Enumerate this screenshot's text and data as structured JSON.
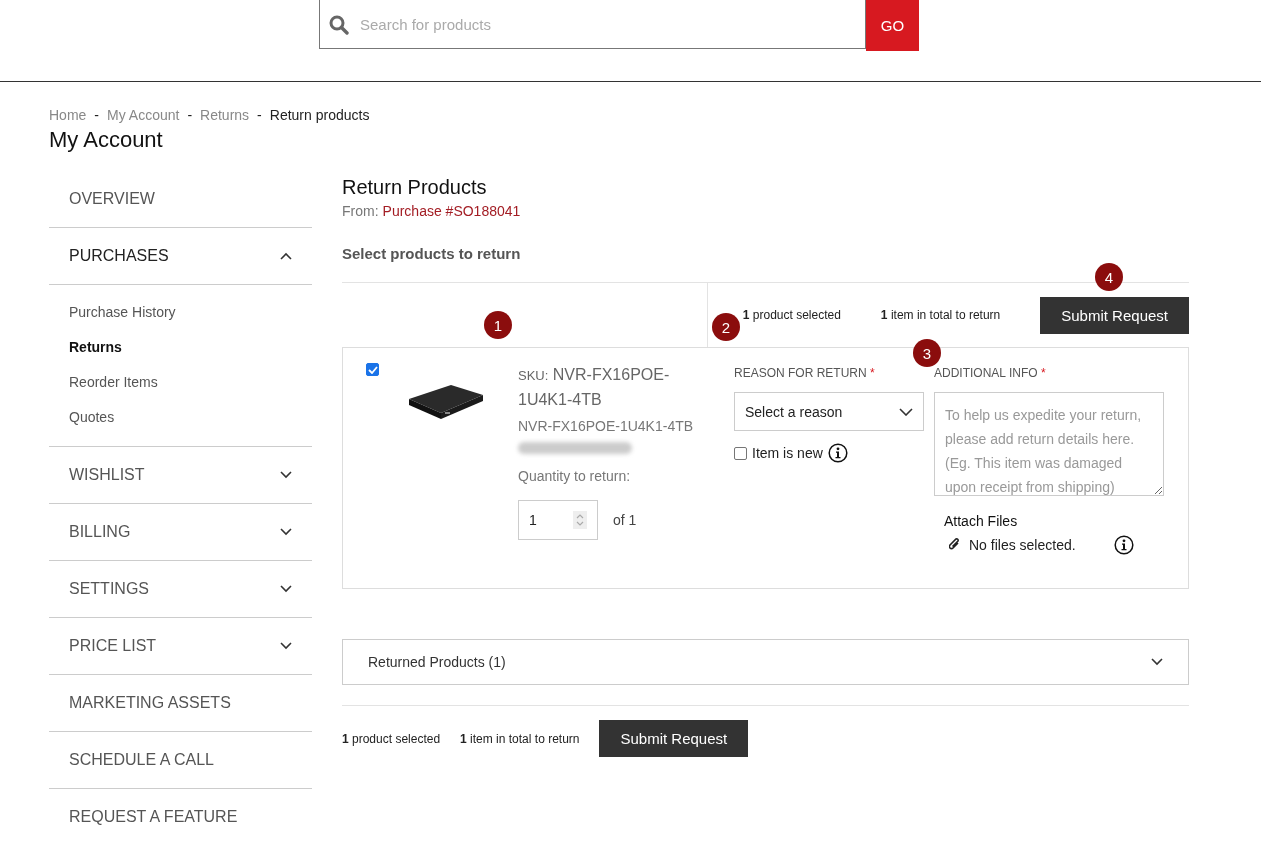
{
  "search": {
    "placeholder": "Search for products",
    "button": "GO"
  },
  "breadcrumbs": [
    {
      "label": "Home",
      "current": false
    },
    {
      "label": "My Account",
      "current": false
    },
    {
      "label": "Returns",
      "current": false
    },
    {
      "label": "Return products",
      "current": true
    }
  ],
  "breadcrumb_separator": "-",
  "page_title": "My Account",
  "sidebar": {
    "items": [
      {
        "label": "OVERVIEW"
      },
      {
        "label": "PURCHASES",
        "expanded": true,
        "children": [
          {
            "label": "Purchase History",
            "selected": false
          },
          {
            "label": "Returns",
            "selected": true
          },
          {
            "label": "Reorder Items",
            "selected": false
          },
          {
            "label": "Quotes",
            "selected": false
          }
        ]
      },
      {
        "label": "WISHLIST",
        "expanded": false
      },
      {
        "label": "BILLING",
        "expanded": false
      },
      {
        "label": "SETTINGS",
        "expanded": false
      },
      {
        "label": "PRICE LIST",
        "expanded": false
      },
      {
        "label": "MARKETING ASSETS"
      },
      {
        "label": "SCHEDULE A CALL"
      },
      {
        "label": "REQUEST A FEATURE"
      }
    ]
  },
  "main": {
    "title": "Return Products",
    "from_label": "From:",
    "from_link": "Purchase #SO188041",
    "subtitle": "Select products to return",
    "summary_top": {
      "selected_count": "1",
      "selected_text": "product selected",
      "total_count": "1",
      "total_text": "item in total to return",
      "button": "Submit Request"
    },
    "product": {
      "checked": true,
      "sku_label": "SKU:",
      "sku": "NVR-FX16POE-1U4K1-4TB",
      "name": "NVR-FX16POE-1U4K1-4TB",
      "quantity_label": "Quantity to return:",
      "quantity": "1",
      "quantity_of": "of 1",
      "reason_label": "REASON FOR RETURN",
      "required_mark": "*",
      "reason_placeholder": "Select a reason",
      "item_is_new_label": "Item is new",
      "item_is_new": false,
      "info_label": "ADDITIONAL INFO",
      "info_placeholder": "To help us expedite your return, please add return details here. (Eg. This item was damaged upon receipt from shipping)",
      "attach_label": "Attach Files",
      "files_text": "No files selected."
    },
    "returned_products": {
      "label": "Returned Products (1)",
      "expanded": false
    },
    "summary_bottom": {
      "selected_count": "1",
      "selected_text": "product selected",
      "total_count": "1",
      "total_text": "item in total to return",
      "button": "Submit Request"
    }
  },
  "annotations": [
    "1",
    "2",
    "3",
    "4"
  ]
}
